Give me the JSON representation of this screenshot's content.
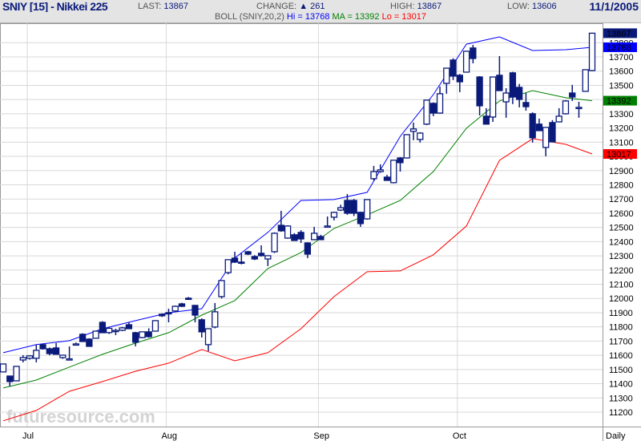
{
  "header": {
    "title": "SNIY [15] - Nikkei 225",
    "last_label": "LAST:",
    "last": "13867",
    "change_label": "CHANGE:",
    "change_icon": "triangle-up-icon",
    "change": "261",
    "high_label": "HIGH:",
    "high": "13867",
    "low_label": "LOW:",
    "low": "13606",
    "date": "11/1/2005"
  },
  "indicator": {
    "name": "BOLL (SNIY,20,2)",
    "hi_text": "Hi = 13768",
    "ma_text": "MA = 13392",
    "lo_text": "Lo = 13017"
  },
  "watermark": "futuresource.com",
  "chart_data": {
    "type": "candlestick",
    "title": "SNIY [15] - Nikkei 225",
    "period_label": "Daily",
    "ylim": [
      11130,
      13920
    ],
    "y_ticks": [
      11200,
      11300,
      11400,
      11500,
      11600,
      11700,
      11800,
      11900,
      12000,
      12100,
      12200,
      12300,
      12400,
      12500,
      12600,
      12700,
      12800,
      12900,
      13000,
      13100,
      13200,
      13300,
      13400,
      13500,
      13600,
      13700,
      13800
    ],
    "months": [
      {
        "label": "Jul",
        "index": 4
      },
      {
        "label": "Aug",
        "index": 25
      },
      {
        "label": "Sep",
        "index": 48
      },
      {
        "label": "Oct",
        "index": 69
      }
    ],
    "candles_ohlc": [
      [
        11483,
        11539,
        11483,
        11539
      ],
      [
        11454,
        11454,
        11381,
        11415
      ],
      [
        11420,
        11522,
        11420,
        11522
      ],
      [
        11567,
        11601,
        11550,
        11584
      ],
      [
        11579,
        11600,
        11570,
        11596
      ],
      [
        11579,
        11675,
        11550,
        11635
      ],
      [
        11675,
        11680,
        11640,
        11646
      ],
      [
        11646,
        11655,
        11600,
        11612
      ],
      [
        11652,
        11686,
        11607,
        11607
      ],
      [
        11584,
        11601,
        11575,
        11601
      ],
      [
        11573,
        11663,
        11567,
        11575
      ],
      [
        11680,
        11690,
        11675,
        11680
      ],
      [
        11748,
        11755,
        11697,
        11697
      ],
      [
        11714,
        11720,
        11663,
        11663
      ],
      [
        11720,
        11770,
        11720,
        11770
      ],
      [
        11832,
        11840,
        11759,
        11759
      ],
      [
        11760,
        11800,
        11750,
        11790
      ],
      [
        11770,
        11787,
        11742,
        11775
      ],
      [
        11776,
        11800,
        11770,
        11793
      ],
      [
        11815,
        11830,
        11787,
        11787
      ],
      [
        11759,
        11765,
        11663,
        11692
      ],
      [
        11725,
        11765,
        11720,
        11765
      ],
      [
        11765,
        11790,
        11725,
        11731
      ],
      [
        11770,
        11844,
        11770,
        11844
      ],
      [
        11889,
        11895,
        11870,
        11878
      ],
      [
        11900,
        11928,
        11832,
        11895
      ],
      [
        11912,
        11950,
        11905,
        11945
      ],
      [
        11962,
        11970,
        11940,
        11945
      ],
      [
        12002,
        12010,
        11990,
        11996
      ],
      [
        11951,
        11955,
        11832,
        11883
      ],
      [
        11850,
        11860,
        11725,
        11765
      ],
      [
        11675,
        11790,
        11629,
        11787
      ],
      [
        11799,
        11968,
        11790,
        11906
      ],
      [
        12013,
        12126,
        12000,
        12126
      ],
      [
        12182,
        12273,
        12170,
        12273
      ],
      [
        12284,
        12329,
        12250,
        12256
      ],
      [
        12256,
        12318,
        12240,
        12250
      ],
      [
        12329,
        12335,
        12305,
        12312
      ],
      [
        12295,
        12305,
        12270,
        12278
      ],
      [
        12318,
        12374,
        12295,
        12301
      ],
      [
        12278,
        12301,
        12228,
        12301
      ],
      [
        12329,
        12465,
        12320,
        12459
      ],
      [
        12515,
        12617,
        12470,
        12476
      ],
      [
        12425,
        12515,
        12420,
        12510
      ],
      [
        12448,
        12460,
        12408,
        12408
      ],
      [
        12465,
        12481,
        12391,
        12419
      ],
      [
        12391,
        12395,
        12284,
        12312
      ],
      [
        12414,
        12504,
        12410,
        12459
      ],
      [
        12436,
        12448,
        12414,
        12414
      ],
      [
        12504,
        12577,
        12500,
        12510
      ],
      [
        12572,
        12610,
        12549,
        12606
      ],
      [
        12622,
        12660,
        12615,
        12639
      ],
      [
        12690,
        12735,
        12589,
        12600
      ],
      [
        12690,
        12700,
        12580,
        12600
      ],
      [
        12606,
        12610,
        12504,
        12527
      ],
      [
        12560,
        12696,
        12555,
        12696
      ],
      [
        12843,
        12933,
        12831,
        12893
      ],
      [
        12893,
        12944,
        12885,
        12905
      ],
      [
        12854,
        12870,
        12830,
        12831
      ],
      [
        12815,
        12973,
        12810,
        12973
      ],
      [
        12989,
        12995,
        12893,
        12956
      ],
      [
        12989,
        13153,
        12985,
        13153
      ],
      [
        13176,
        13238,
        13114,
        13193
      ],
      [
        13119,
        13170,
        13097,
        13164
      ],
      [
        13227,
        13396,
        13220,
        13396
      ],
      [
        13373,
        13380,
        13283,
        13305
      ],
      [
        13305,
        13492,
        13300,
        13441
      ],
      [
        13514,
        13621,
        13441,
        13621
      ],
      [
        13678,
        13690,
        13537,
        13565
      ],
      [
        13571,
        13580,
        13452,
        13525
      ],
      [
        13593,
        13740,
        13590,
        13740
      ],
      [
        13763,
        13785,
        13655,
        13689
      ],
      [
        13559,
        13565,
        13288,
        13356
      ],
      [
        13283,
        13339,
        13227,
        13227
      ],
      [
        13277,
        13559,
        13243,
        13559
      ],
      [
        13571,
        13706,
        13463,
        13463
      ],
      [
        13384,
        13480,
        13272,
        13446
      ],
      [
        13588,
        13595,
        13368,
        13418
      ],
      [
        13486,
        13510,
        13345,
        13401
      ],
      [
        13379,
        13446,
        13322,
        13350
      ],
      [
        13300,
        13310,
        13097,
        13131
      ],
      [
        13227,
        13266,
        13181,
        13181
      ],
      [
        13063,
        13204,
        13001,
        13204
      ],
      [
        13238,
        13255,
        13102,
        13102
      ],
      [
        13243,
        13339,
        13240,
        13283
      ],
      [
        13300,
        13396,
        13295,
        13390
      ],
      [
        13446,
        13503,
        13390,
        13418
      ],
      [
        13345,
        13384,
        13272,
        13345
      ],
      [
        13458,
        13610,
        13455,
        13610
      ],
      [
        13604,
        13870,
        13600,
        13867
      ]
    ],
    "band_index": [
      0,
      5,
      10,
      15,
      20,
      25,
      30,
      35,
      40,
      45,
      50,
      55,
      60,
      65,
      70,
      75,
      80,
      85,
      89
    ],
    "series": [
      {
        "name": "Hi",
        "color": "#0000ff",
        "values": [
          11618,
          11675,
          11703,
          11787,
          11844,
          11900,
          11928,
          12284,
          12465,
          12690,
          12696,
          12747,
          13141,
          13435,
          13790,
          13841,
          13745,
          13751,
          13768
        ]
      },
      {
        "name": "MA",
        "color": "#008000",
        "values": [
          11370,
          11426,
          11517,
          11607,
          11686,
          11759,
          11883,
          11985,
          12211,
          12323,
          12493,
          12589,
          12690,
          12893,
          13198,
          13390,
          13463,
          13413,
          13392
        ]
      },
      {
        "name": "Lo",
        "color": "#ff0000",
        "values": [
          11139,
          11212,
          11347,
          11415,
          11488,
          11545,
          11641,
          11561,
          11618,
          11787,
          12013,
          12188,
          12194,
          12307,
          12510,
          12972,
          13125,
          13085,
          13017
        ]
      }
    ],
    "markers": [
      {
        "label": "13867",
        "value": 13867,
        "color": "#0a1a7a"
      },
      {
        "label": "13768",
        "value": 13768,
        "color": "#0000ff"
      },
      {
        "label": "13392",
        "value": 13392,
        "color": "#008000"
      },
      {
        "label": "13017",
        "value": 13017,
        "color": "#ff0000"
      }
    ],
    "candle_color": "#0a1a7a",
    "grid": true
  }
}
